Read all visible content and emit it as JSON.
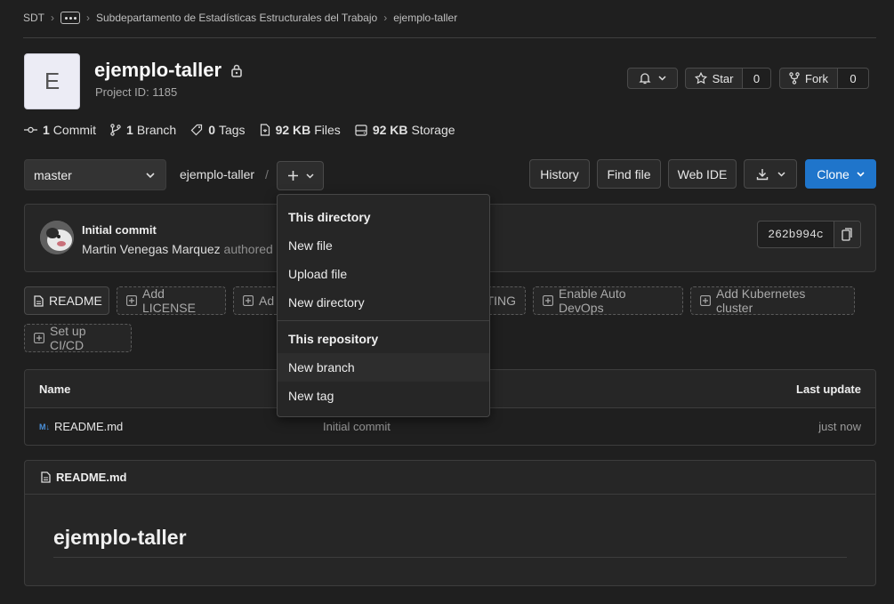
{
  "breadcrumb": {
    "root": "SDT",
    "group": "Subdepartamento de Estadísticas Estructurales del Trabajo",
    "project": "ejemplo-taller"
  },
  "project": {
    "avatar_letter": "E",
    "name": "ejemplo-taller",
    "id_label": "Project ID: 1185"
  },
  "actions": {
    "star_label": "Star",
    "star_count": "0",
    "fork_label": "Fork",
    "fork_count": "0"
  },
  "stats": {
    "commits_num": "1",
    "commits_label": "Commit",
    "branches_num": "1",
    "branches_label": "Branch",
    "tags_num": "0",
    "tags_label": "Tags",
    "files_num": "92 KB",
    "files_label": "Files",
    "storage_num": "92 KB",
    "storage_label": "Storage"
  },
  "toolbar": {
    "branch": "master",
    "path": "ejemplo-taller",
    "slash": "/",
    "history": "History",
    "find_file": "Find file",
    "web_ide": "Web IDE",
    "clone": "Clone"
  },
  "commit": {
    "title": "Initial commit",
    "author": "Martin Venegas Marquez",
    "authored": "authored",
    "sha": "262b994c"
  },
  "quick_actions": {
    "readme": "README",
    "add_license": "Add LICENSE",
    "add_partial": "Ad",
    "contributing_partial": "TING",
    "auto_devops": "Enable Auto DevOps",
    "k8s": "Add Kubernetes cluster",
    "cicd": "Set up CI/CD"
  },
  "table": {
    "headers": {
      "name": "Name",
      "last_update": "Last update"
    },
    "rows": [
      {
        "name": "README.md",
        "commit": "Initial commit",
        "updated": "just now"
      }
    ]
  },
  "readme": {
    "filename": "README.md",
    "heading": "ejemplo-taller"
  },
  "dropdown": {
    "section1": "This directory",
    "items1": [
      "New file",
      "Upload file",
      "New directory"
    ],
    "section2": "This repository",
    "items2": [
      "New branch",
      "New tag"
    ]
  },
  "colors": {
    "accent": "#1f75cb",
    "background": "#1f1f1f"
  }
}
